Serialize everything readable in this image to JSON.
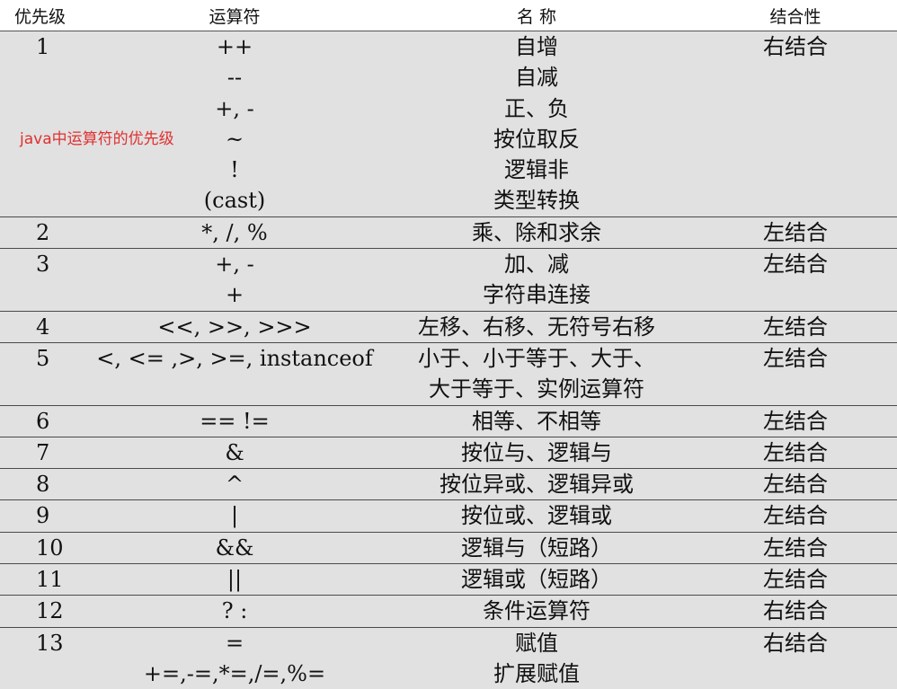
{
  "headers": {
    "priority": "优先级",
    "operator": "运算符",
    "name": "名 称",
    "associativity": "结合性"
  },
  "annotation": "java中运算符的优先级",
  "rows": [
    {
      "priority": "1",
      "operators": [
        "++",
        "--",
        "+, -",
        "~",
        "!",
        "(cast)"
      ],
      "names": [
        "自增",
        "自减",
        "正、负",
        "按位取反",
        "逻辑非",
        "类型转换"
      ],
      "associativity": "右结合"
    },
    {
      "priority": "2",
      "operators": [
        "*, /, %"
      ],
      "names": [
        "乘、除和求余"
      ],
      "associativity": "左结合"
    },
    {
      "priority": "3",
      "operators": [
        "+, -",
        "+"
      ],
      "names": [
        "加、减",
        "字符串连接"
      ],
      "associativity": "左结合"
    },
    {
      "priority": "4",
      "operators": [
        "<<, >>, >>>"
      ],
      "names": [
        "左移、右移、无符号右移"
      ],
      "associativity": "左结合"
    },
    {
      "priority": "5",
      "operators": [
        "<, <= ,>, >=, instanceof",
        ""
      ],
      "names": [
        "小于、小于等于、大于、",
        "大于等于、实例运算符"
      ],
      "associativity": "左结合"
    },
    {
      "priority": "6",
      "operators": [
        "==  !="
      ],
      "names": [
        "相等、不相等"
      ],
      "associativity": "左结合"
    },
    {
      "priority": "7",
      "operators": [
        "&"
      ],
      "names": [
        "按位与、逻辑与"
      ],
      "associativity": "左结合"
    },
    {
      "priority": "8",
      "operators": [
        "^"
      ],
      "names": [
        "按位异或、逻辑异或"
      ],
      "associativity": "左结合"
    },
    {
      "priority": "9",
      "operators": [
        "|"
      ],
      "names": [
        "按位或、逻辑或"
      ],
      "associativity": "左结合"
    },
    {
      "priority": "10",
      "operators": [
        "&&"
      ],
      "names": [
        "逻辑与（短路）"
      ],
      "associativity": "左结合"
    },
    {
      "priority": "11",
      "operators": [
        "||"
      ],
      "names": [
        "逻辑或（短路）"
      ],
      "associativity": "左结合"
    },
    {
      "priority": "12",
      "operators": [
        "? :"
      ],
      "names": [
        "条件运算符"
      ],
      "associativity": "右结合"
    },
    {
      "priority": "13",
      "operators": [
        "=",
        "+=,-=,*=,/=,%="
      ],
      "names": [
        "赋值",
        "扩展赋值"
      ],
      "associativity": "右结合"
    }
  ]
}
